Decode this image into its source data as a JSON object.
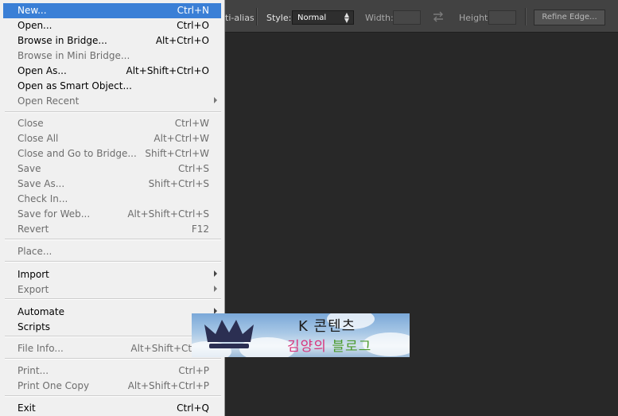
{
  "options_bar": {
    "anti_alias": "ti-alias",
    "style_label": "Style:",
    "style_value": "Normal",
    "width_label": "Width:",
    "height_label": "Height:",
    "refine_button": "Refine Edge..."
  },
  "file_menu": {
    "items": [
      {
        "label": "New...",
        "shortcut": "Ctrl+N",
        "enabled": true,
        "highlighted": true
      },
      {
        "label": "Open...",
        "shortcut": "Ctrl+O",
        "enabled": true
      },
      {
        "label": "Browse in Bridge...",
        "shortcut": "Alt+Ctrl+O",
        "enabled": true
      },
      {
        "label": "Browse in Mini Bridge...",
        "shortcut": "",
        "enabled": false
      },
      {
        "label": "Open As...",
        "shortcut": "Alt+Shift+Ctrl+O",
        "enabled": true
      },
      {
        "label": "Open as Smart Object...",
        "shortcut": "",
        "enabled": true
      },
      {
        "label": "Open Recent",
        "shortcut": "",
        "enabled": false,
        "submenu": true
      },
      {
        "label": "Close",
        "shortcut": "Ctrl+W",
        "enabled": false
      },
      {
        "label": "Close All",
        "shortcut": "Alt+Ctrl+W",
        "enabled": false
      },
      {
        "label": "Close and Go to Bridge...",
        "shortcut": "Shift+Ctrl+W",
        "enabled": false
      },
      {
        "label": "Save",
        "shortcut": "Ctrl+S",
        "enabled": false
      },
      {
        "label": "Save As...",
        "shortcut": "Shift+Ctrl+S",
        "enabled": false
      },
      {
        "label": "Check In...",
        "shortcut": "",
        "enabled": false
      },
      {
        "label": "Save for Web...",
        "shortcut": "Alt+Shift+Ctrl+S",
        "enabled": false
      },
      {
        "label": "Revert",
        "shortcut": "F12",
        "enabled": false
      },
      {
        "label": "Place...",
        "shortcut": "",
        "enabled": false
      },
      {
        "label": "Import",
        "shortcut": "",
        "enabled": true,
        "submenu": true
      },
      {
        "label": "Export",
        "shortcut": "",
        "enabled": false,
        "submenu": true
      },
      {
        "label": "Automate",
        "shortcut": "",
        "enabled": true,
        "submenu": true
      },
      {
        "label": "Scripts",
        "shortcut": "",
        "enabled": true,
        "submenu": true
      },
      {
        "label": "File Info...",
        "shortcut": "Alt+Shift+Ctrl+I",
        "enabled": false
      },
      {
        "label": "Print...",
        "shortcut": "Ctrl+P",
        "enabled": false
      },
      {
        "label": "Print One Copy",
        "shortcut": "Alt+Shift+Ctrl+P",
        "enabled": false
      },
      {
        "label": "Exit",
        "shortcut": "Ctrl+Q",
        "enabled": true
      }
    ]
  },
  "watermark": {
    "line1": "K 콘텐츠",
    "line2_a": "김양의",
    "line2_b": "블로그"
  },
  "colors": {
    "highlight": "#3a7fd6",
    "canvas": "#282828",
    "menu_bg": "#f0f0f0"
  }
}
